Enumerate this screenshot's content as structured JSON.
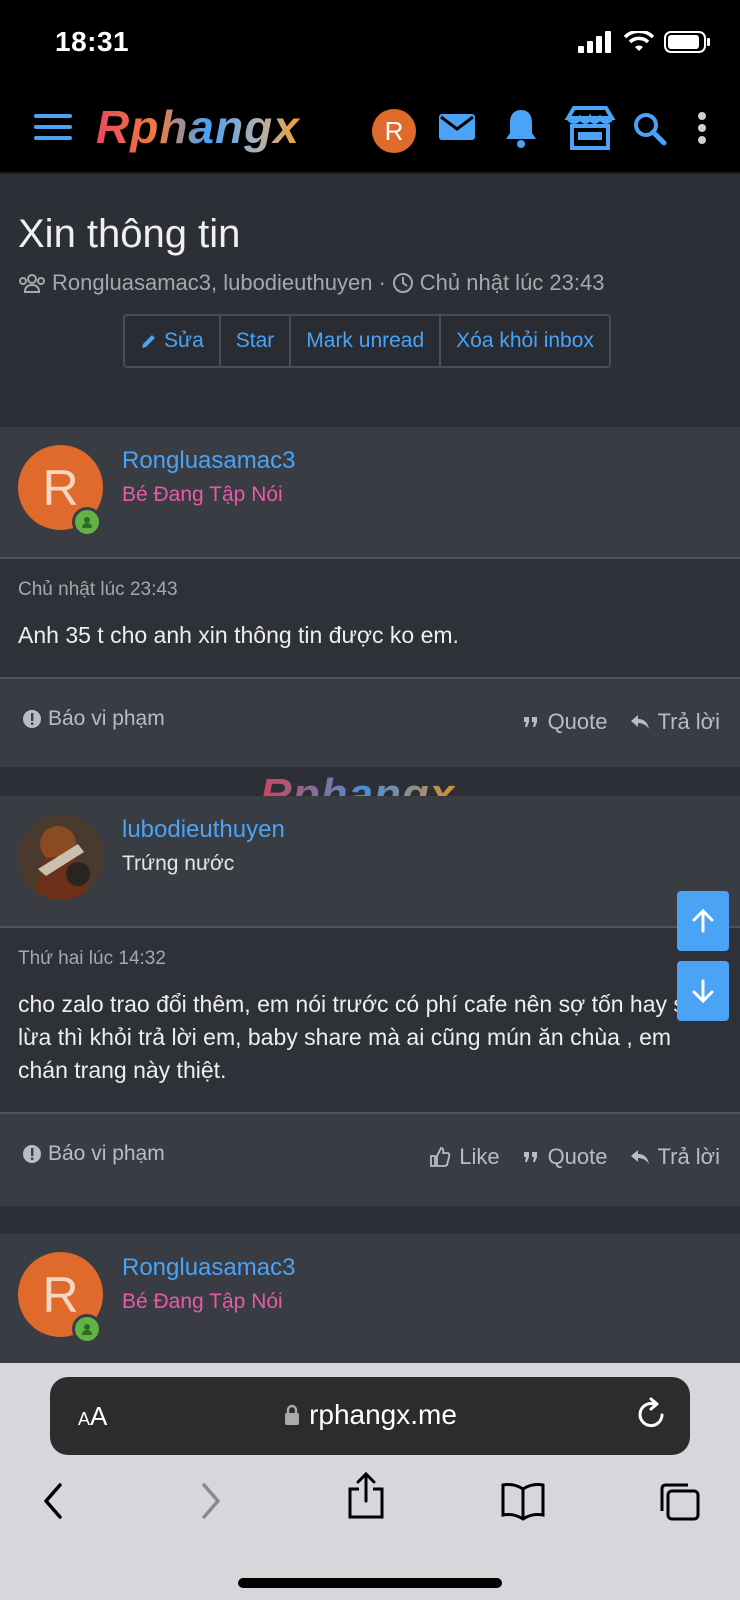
{
  "status": {
    "time": "18:31"
  },
  "header": {
    "logo": "Rphangx",
    "avatar_letter": "R"
  },
  "thread": {
    "title": "Xin thông tin",
    "participants": "Rongluasamac3, lubodieuthuyen",
    "separator": "·",
    "time": "Chủ nhật lúc 23:43",
    "buttons": {
      "edit": "Sửa",
      "star": "Star",
      "mark_unread": "Mark unread",
      "remove": "Xóa khỏi inbox"
    }
  },
  "posts": [
    {
      "avatar_letter": "R",
      "username": "Rongluasamac3",
      "user_title": "Bé Đang Tập Nói",
      "user_title_color": "#e85aa8",
      "date": "Chủ nhật lúc 23:43",
      "text": "Anh 35 t cho anh xin thông tin được ko em.",
      "report": "Báo vi phạm",
      "quote": "Quote",
      "reply": "Trả lời"
    },
    {
      "username": "lubodieuthuyen",
      "user_title": "Trứng nước",
      "user_title_color": "#e6e6e6",
      "date": "Thứ hai lúc 14:32",
      "text": "cho zalo trao đổi thêm, em nói trước có phí cafe nên sợ tốn hay sợ lừa thì khỏi trả lời em, baby share mà ai cũng mún ăn chùa , em chán trang này thiệt.",
      "report": "Báo vi phạm",
      "like": "Like",
      "quote": "Quote",
      "reply": "Trả lời"
    },
    {
      "avatar_letter": "R",
      "username": "Rongluasamac3",
      "user_title": "Bé Đang Tập Nói",
      "user_title_color": "#e85aa8"
    }
  ],
  "watermark": "Rphangx",
  "browser": {
    "aa_small": "A",
    "aa_big": "A",
    "url": "rphangx.me"
  },
  "colors": {
    "accent": "#4aa3f5",
    "avatar": "#e06a2c",
    "online": "#63b246"
  }
}
